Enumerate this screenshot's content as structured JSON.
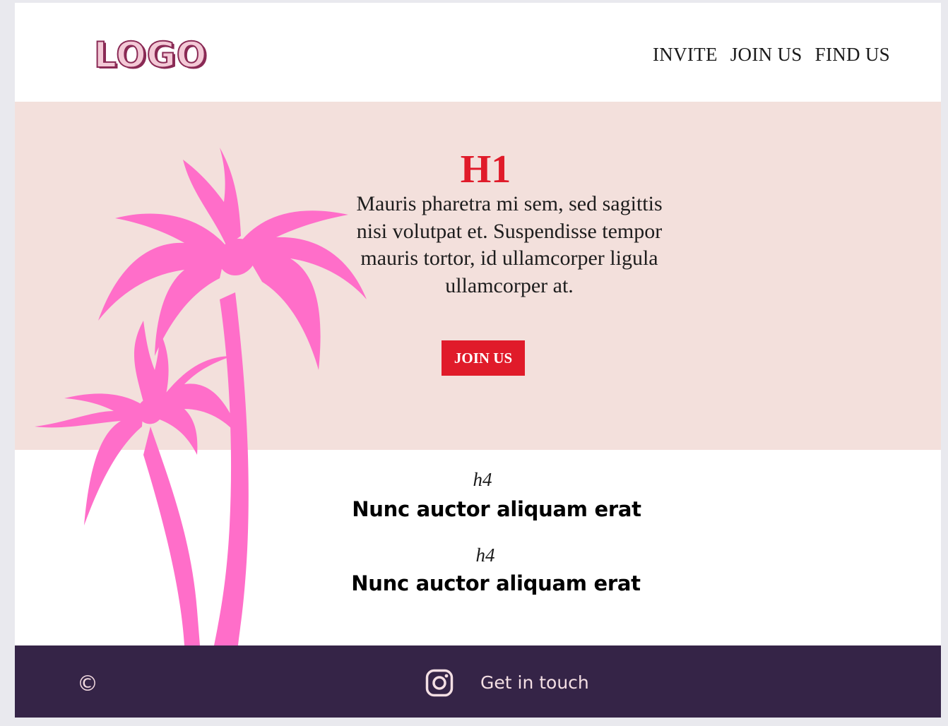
{
  "header": {
    "logo_text": "LOGO",
    "nav": [
      "INVITE",
      "JOIN US",
      "FIND US"
    ]
  },
  "hero": {
    "title": "H1",
    "text": "Mauris pharetra mi sem, sed sagittis nisi volutpat et. Suspendisse tempor mauris tortor, id ullamcorper ligula ullamcorper at.",
    "button_label": "JOIN US"
  },
  "features": [
    {
      "heading": "h4",
      "text": "Nunc auctor aliquam erat"
    },
    {
      "heading": "h4",
      "text": "Nunc auctor aliquam erat"
    }
  ],
  "footer": {
    "copyright_symbol": "©",
    "instagram_icon": "instagram-icon",
    "contact_label": "Get in touch"
  },
  "colors": {
    "accent": "#e01b2a",
    "hero_bg": "#f3e0dc",
    "footer_bg": "#352447",
    "palm": "#ff6ec9"
  }
}
